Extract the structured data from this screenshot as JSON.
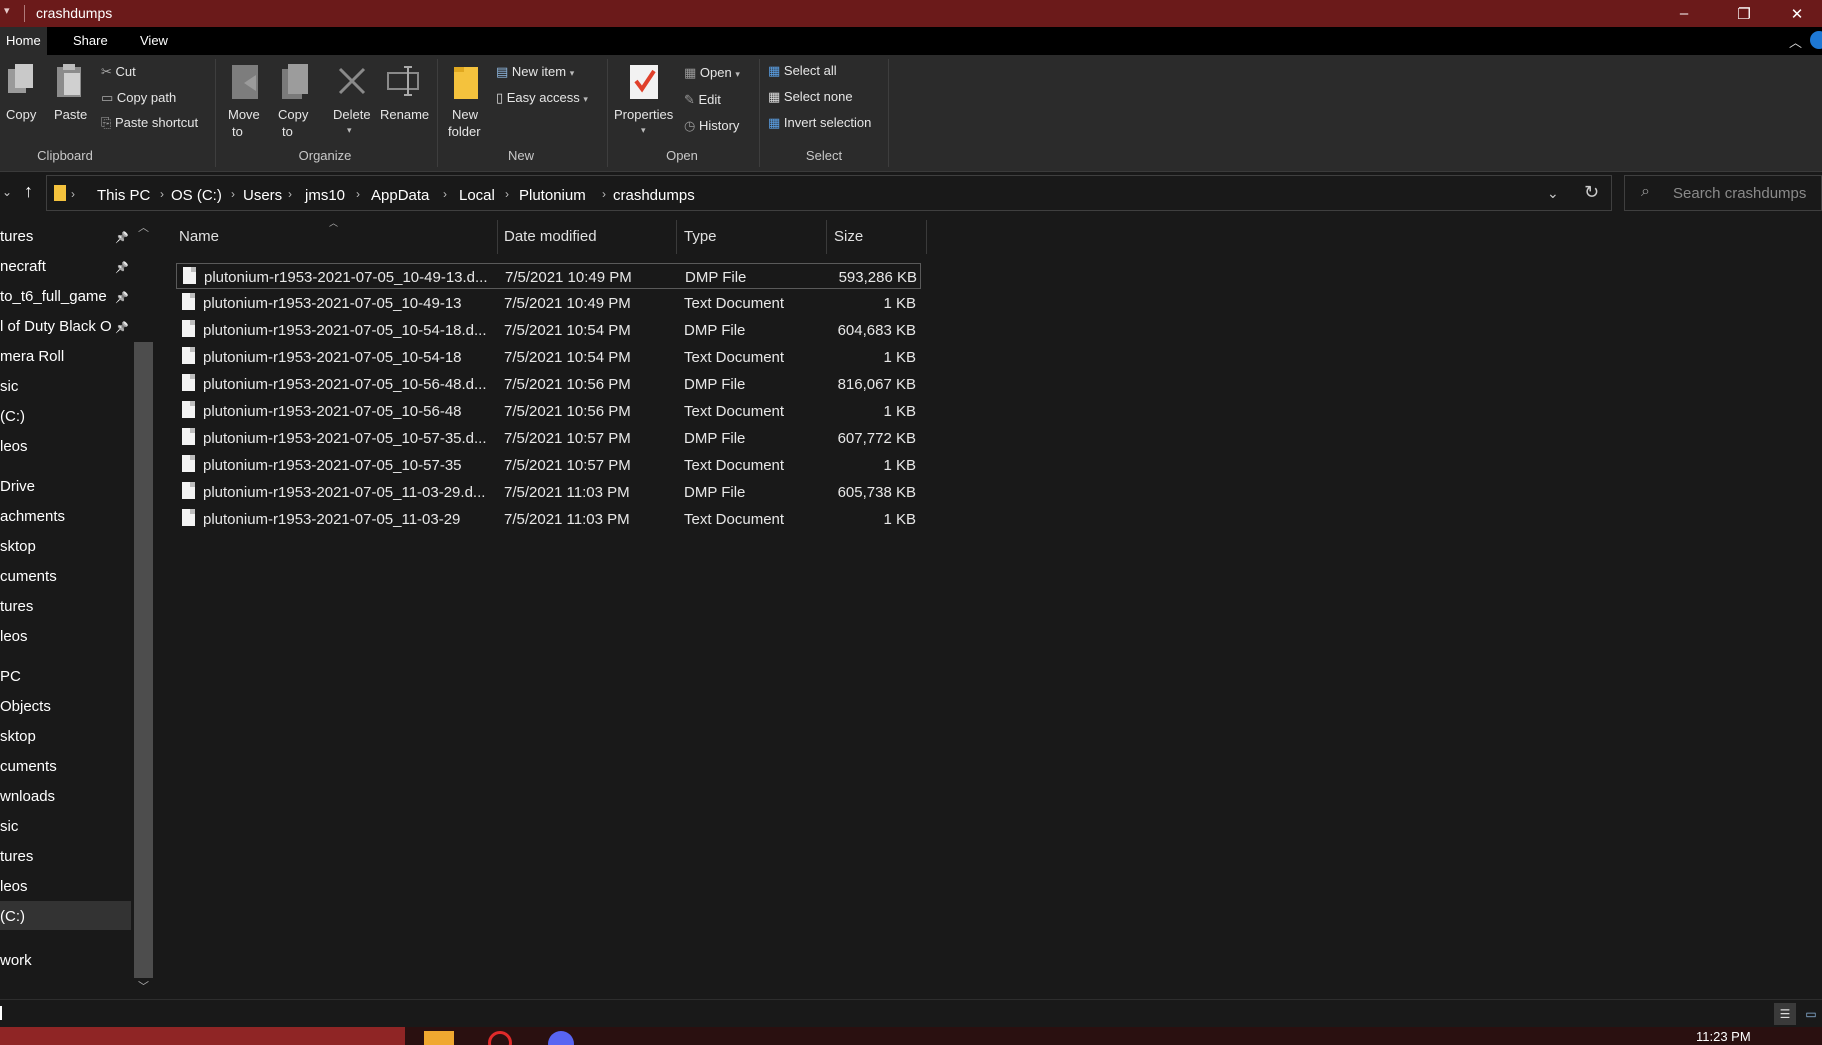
{
  "window": {
    "title": "crashdumps",
    "quick_access_glyph": "▾",
    "minimize_glyph": "–",
    "restore_glyph": "❐",
    "close_glyph": "✕"
  },
  "ribbon_tabs": [
    "Home",
    "Share",
    "View"
  ],
  "ribbon": {
    "clipboard": {
      "group": "Clipboard",
      "copy": "Copy",
      "paste": "Paste",
      "cut": "Cut",
      "copy_path": "Copy path",
      "paste_shortcut": "Paste shortcut"
    },
    "organize": {
      "group": "Organize",
      "move_to_1": "Move",
      "move_to_2": "to",
      "copy_to_1": "Copy",
      "copy_to_2": "to",
      "delete": "Delete",
      "rename": "Rename"
    },
    "new": {
      "group": "New",
      "new_folder_1": "New",
      "new_folder_2": "folder",
      "new_item": "New item",
      "easy_access": "Easy access"
    },
    "open": {
      "group": "Open",
      "properties": "Properties",
      "open": "Open",
      "edit": "Edit",
      "history": "History"
    },
    "select": {
      "group": "Select",
      "select_all": "Select all",
      "select_none": "Select none",
      "invert_selection": "Invert selection"
    }
  },
  "address": {
    "breadcrumbs": [
      "This PC",
      "OS (C:)",
      "Users",
      "jms10",
      "AppData",
      "Local",
      "Plutonium",
      "crashdumps"
    ],
    "search_placeholder": "Search crashdumps"
  },
  "nav_items": [
    {
      "label": "tures",
      "pinned": true
    },
    {
      "label": "necraft",
      "pinned": true
    },
    {
      "label": "to_t6_full_game",
      "pinned": true
    },
    {
      "label": "l of Duty Black O",
      "pinned": true
    },
    {
      "label": "mera Roll",
      "pinned": false
    },
    {
      "label": "sic",
      "pinned": false
    },
    {
      "label": "(C:)",
      "pinned": false
    },
    {
      "label": "leos",
      "pinned": false
    },
    {
      "label": "Drive",
      "pinned": false
    },
    {
      "label": "achments",
      "pinned": false
    },
    {
      "label": "sktop",
      "pinned": false
    },
    {
      "label": "cuments",
      "pinned": false
    },
    {
      "label": "tures",
      "pinned": false
    },
    {
      "label": "leos",
      "pinned": false
    },
    {
      "label": "PC",
      "pinned": false
    },
    {
      "label": "Objects",
      "pinned": false
    },
    {
      "label": "sktop",
      "pinned": false
    },
    {
      "label": "cuments",
      "pinned": false
    },
    {
      "label": "wnloads",
      "pinned": false
    },
    {
      "label": "sic",
      "pinned": false
    },
    {
      "label": "tures",
      "pinned": false
    },
    {
      "label": "leos",
      "pinned": false
    },
    {
      "label": "(C:)",
      "pinned": false,
      "selected": true
    },
    {
      "label": "work",
      "pinned": false
    }
  ],
  "columns": {
    "name": "Name",
    "date": "Date modified",
    "type": "Type",
    "size": "Size"
  },
  "files": [
    {
      "name": "plutonium-r1953-2021-07-05_10-49-13.d...",
      "date": "7/5/2021 10:49 PM",
      "type": "DMP File",
      "size": "593,286 KB"
    },
    {
      "name": "plutonium-r1953-2021-07-05_10-49-13",
      "date": "7/5/2021 10:49 PM",
      "type": "Text Document",
      "size": "1 KB"
    },
    {
      "name": "plutonium-r1953-2021-07-05_10-54-18.d...",
      "date": "7/5/2021 10:54 PM",
      "type": "DMP File",
      "size": "604,683 KB"
    },
    {
      "name": "plutonium-r1953-2021-07-05_10-54-18",
      "date": "7/5/2021 10:54 PM",
      "type": "Text Document",
      "size": "1 KB"
    },
    {
      "name": "plutonium-r1953-2021-07-05_10-56-48.d...",
      "date": "7/5/2021 10:56 PM",
      "type": "DMP File",
      "size": "816,067 KB"
    },
    {
      "name": "plutonium-r1953-2021-07-05_10-56-48",
      "date": "7/5/2021 10:56 PM",
      "type": "Text Document",
      "size": "1 KB"
    },
    {
      "name": "plutonium-r1953-2021-07-05_10-57-35.d...",
      "date": "7/5/2021 10:57 PM",
      "type": "DMP File",
      "size": "607,772 KB"
    },
    {
      "name": "plutonium-r1953-2021-07-05_10-57-35",
      "date": "7/5/2021 10:57 PM",
      "type": "Text Document",
      "size": "1 KB"
    },
    {
      "name": "plutonium-r1953-2021-07-05_11-03-29.d...",
      "date": "7/5/2021 11:03 PM",
      "type": "DMP File",
      "size": "605,738 KB"
    },
    {
      "name": "plutonium-r1953-2021-07-05_11-03-29",
      "date": "7/5/2021 11:03 PM",
      "type": "Text Document",
      "size": "1 KB"
    }
  ],
  "taskbar": {
    "clock": "11:23 PM"
  },
  "colors": {
    "titlebar": "#6b1a1a",
    "background": "#191919",
    "ribbon": "#2b2b2b",
    "accent": "#1e78d4"
  }
}
